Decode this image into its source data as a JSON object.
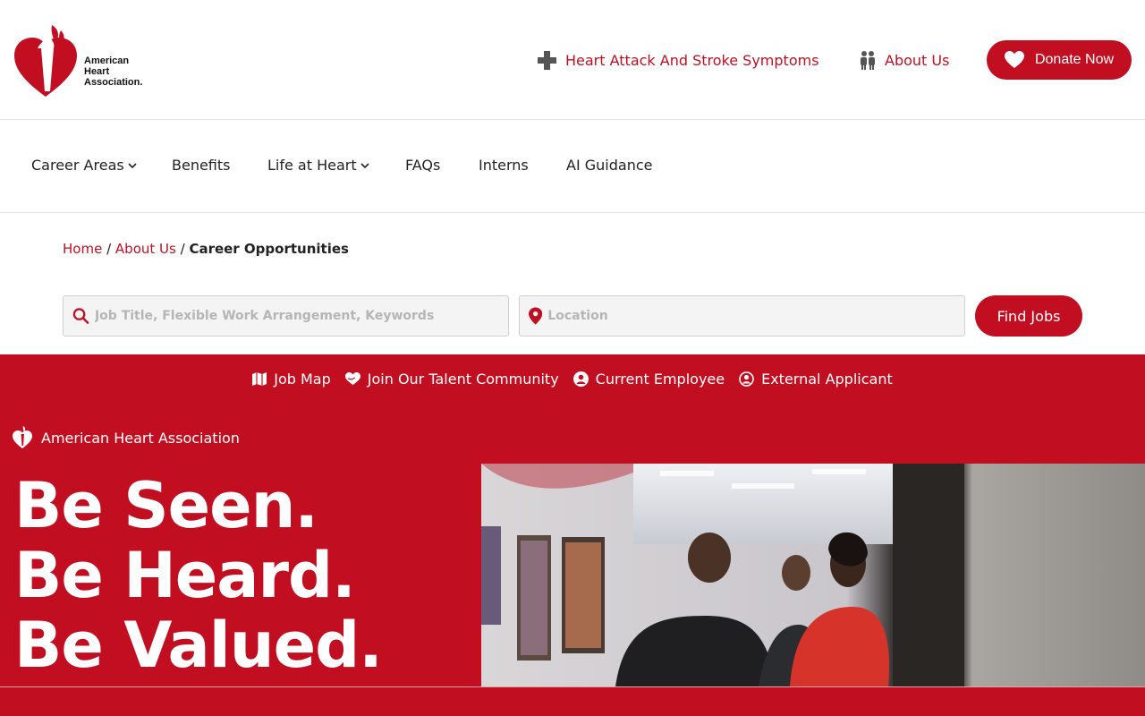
{
  "header": {
    "logo_lines": [
      "American",
      "Heart",
      "Association."
    ],
    "util_links": [
      {
        "label": "Heart Attack And Stroke Symptoms",
        "icon": "plus-cross-icon"
      },
      {
        "label": "About Us",
        "icon": "people-icon"
      }
    ],
    "donate_label": "Donate Now"
  },
  "nav": {
    "items": [
      {
        "label": "Career Areas",
        "has_dropdown": true
      },
      {
        "label": "Benefits",
        "has_dropdown": false
      },
      {
        "label": "Life at Heart",
        "has_dropdown": true
      },
      {
        "label": "FAQs",
        "has_dropdown": false
      },
      {
        "label": "Interns",
        "has_dropdown": false
      },
      {
        "label": "AI Guidance",
        "has_dropdown": false
      }
    ]
  },
  "breadcrumb": {
    "items": [
      "Home",
      "About Us"
    ],
    "current": "Career Opportunities"
  },
  "search": {
    "keyword_placeholder": "Job Title, Flexible Work Arrangement, Keywords",
    "location_placeholder": "Location",
    "find_label": "Find Jobs"
  },
  "quick_links": [
    {
      "label": "Job Map",
      "icon": "map-icon"
    },
    {
      "label": "Join Our Talent Community",
      "icon": "heart-hand-icon"
    },
    {
      "label": "Current Employee",
      "icon": "user-circle-icon"
    },
    {
      "label": "External Applicant",
      "icon": "user-circle-outline-icon"
    }
  ],
  "hero": {
    "brand": "American Heart Association",
    "headline": [
      "Be Seen.",
      "Be Heard.",
      "Be Valued."
    ]
  },
  "colors": {
    "brand_red": "#c10e21",
    "white": "#ffffff"
  }
}
